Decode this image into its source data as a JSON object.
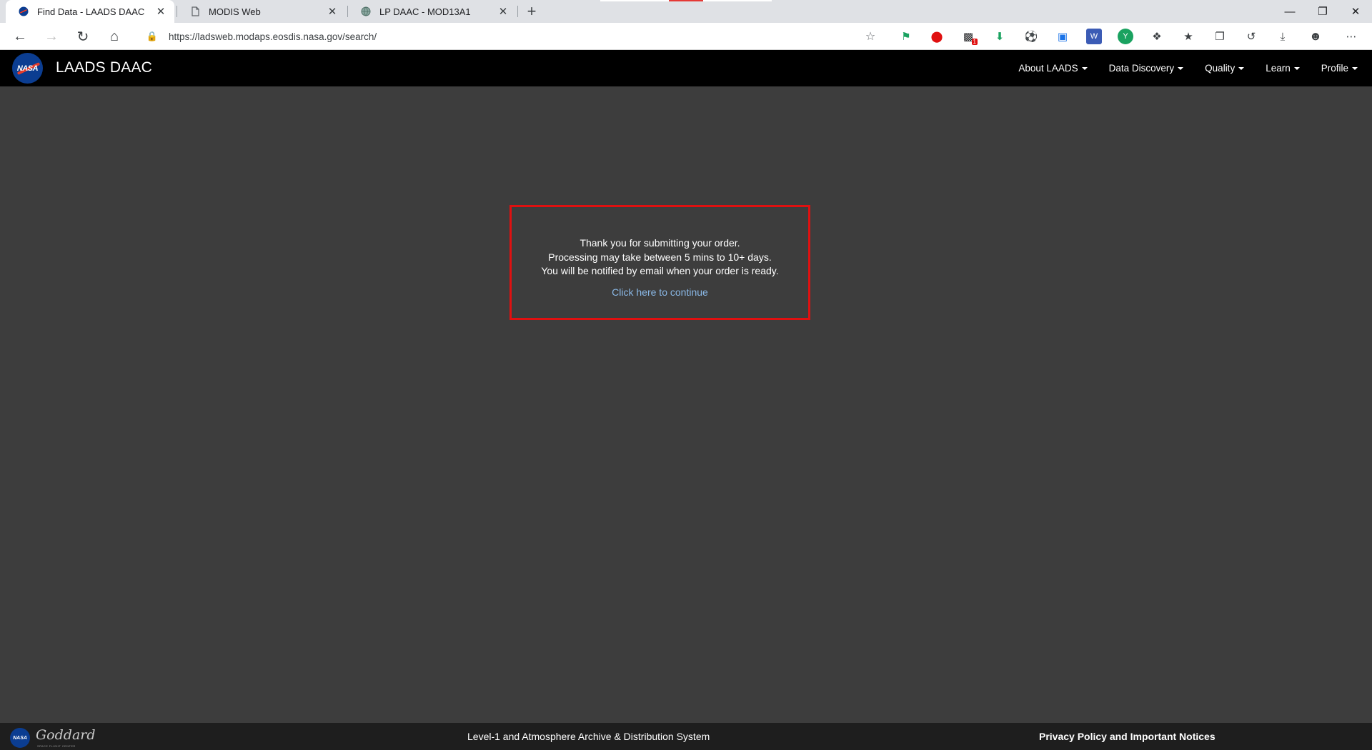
{
  "browser": {
    "tabs": [
      {
        "title": "Find Data - LAADS DAAC",
        "active": true,
        "icon": "nasa-favicon"
      },
      {
        "title": "MODIS Web",
        "active": false,
        "icon": "page-icon"
      },
      {
        "title": "LP DAAC - MOD13A1",
        "active": false,
        "icon": "globe-icon"
      }
    ],
    "close_glyph": "✕",
    "newtab_glyph": "+",
    "url": "https://ladsweb.modaps.eosdis.nasa.gov/search/",
    "extension_badge": "1"
  },
  "site": {
    "logo_text": "NASA",
    "name": "LAADS DAAC",
    "nav": [
      {
        "label": "About LAADS"
      },
      {
        "label": "Data Discovery"
      },
      {
        "label": "Quality"
      },
      {
        "label": "Learn"
      },
      {
        "label": "Profile"
      }
    ]
  },
  "message": {
    "line1": "Thank you for submitting your order.",
    "line2": "Processing may take between 5 mins to 10+ days.",
    "line3": "You will be notified by email when your order is ready.",
    "continue_link": "Click here to continue",
    "border_color": "#e01010"
  },
  "footer": {
    "logo_text": "NASA",
    "goddard": "Goddard",
    "goddard_sub": "SPACE FLIGHT CENTER",
    "center_text": "Level-1 and Atmosphere Archive & Distribution System",
    "privacy_link": "Privacy Policy and Important Notices"
  },
  "colors": {
    "page_bg": "#3d3d3d",
    "header_bg": "#000000",
    "footer_bg": "#1e1e1e",
    "link": "#8ab8e6"
  }
}
